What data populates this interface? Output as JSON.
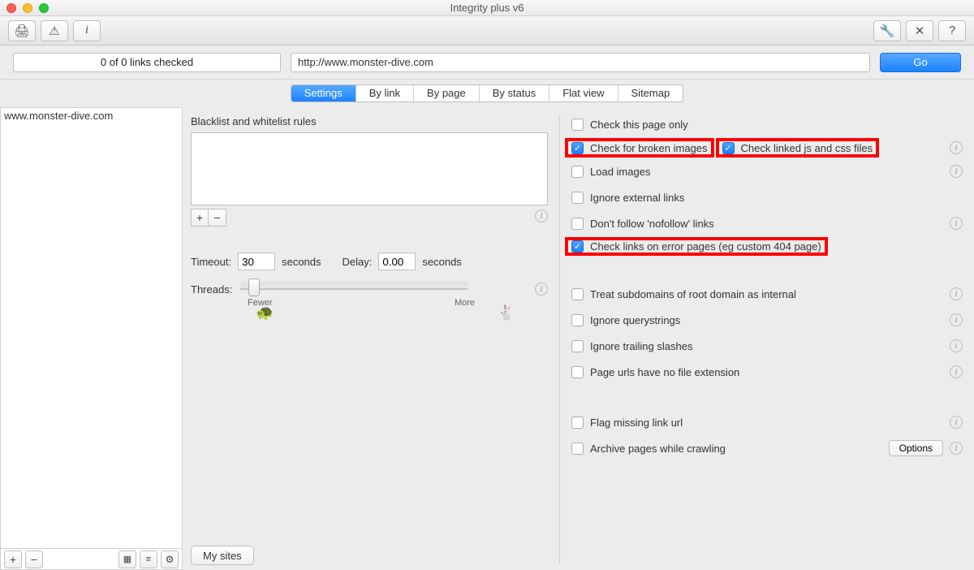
{
  "window": {
    "title": "Integrity plus v6"
  },
  "toolbar": {
    "print_icon": "print-icon",
    "warn_icon": "warning-icon",
    "info_icon": "info-icon",
    "wrench_icon": "wrench-icon",
    "tools_icon": "tools-icon",
    "help_icon": "help-icon",
    "status": "0 of 0 links checked",
    "url": "http://www.monster-dive.com",
    "go_label": "Go"
  },
  "tabs": [
    "Settings",
    "By link",
    "By page",
    "By status",
    "Flat view",
    "Sitemap"
  ],
  "active_tab": 0,
  "sidebar": {
    "items": [
      "www.monster-dive.com"
    ]
  },
  "left": {
    "bw_title": "Blacklist and whitelist rules",
    "timeout_label": "Timeout:",
    "timeout_value": "30",
    "timeout_unit": "seconds",
    "delay_label": "Delay:",
    "delay_value": "0.00",
    "delay_unit": "seconds",
    "threads_label": "Threads:",
    "slider_fewer": "Fewer",
    "slider_more": "More",
    "my_sites": "My sites"
  },
  "right": {
    "options_label": "Options",
    "checks": [
      {
        "label": "Check this page only",
        "checked": false,
        "info": false,
        "hl": false
      },
      {
        "label": "Check for broken images",
        "checked": true,
        "info": false,
        "hl": true
      },
      {
        "label": "Check linked js and css files",
        "checked": true,
        "info": true,
        "hl": true
      },
      {
        "label": "Load images",
        "checked": false,
        "info": true,
        "hl": false
      },
      {
        "label": "Ignore external links",
        "checked": false,
        "info": false,
        "hl": false
      },
      {
        "label": "Don't follow 'nofollow' links",
        "checked": false,
        "info": true,
        "hl": false
      },
      {
        "label": "Check links on error pages (eg custom 404 page)",
        "checked": true,
        "info": false,
        "hl": true
      },
      {
        "label": "Treat subdomains of root domain as internal",
        "checked": false,
        "info": true,
        "hl": false
      },
      {
        "label": "Ignore querystrings",
        "checked": false,
        "info": true,
        "hl": false
      },
      {
        "label": "Ignore trailing slashes",
        "checked": false,
        "info": true,
        "hl": false
      },
      {
        "label": "Page urls have no file extension",
        "checked": false,
        "info": true,
        "hl": false
      },
      {
        "label": "Flag missing link url",
        "checked": false,
        "info": true,
        "hl": false
      },
      {
        "label": "Archive pages while crawling",
        "checked": false,
        "info": true,
        "hl": false,
        "options": true
      }
    ]
  }
}
